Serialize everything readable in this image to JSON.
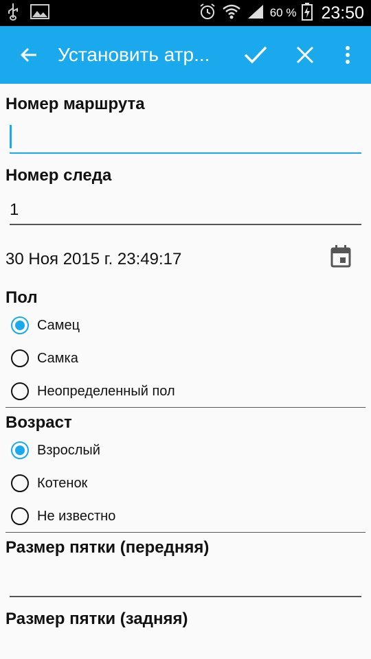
{
  "status_bar": {
    "battery_percent": "60 %",
    "time": "23:50"
  },
  "toolbar": {
    "title": "Установить атр..."
  },
  "form": {
    "route_number": {
      "label": "Номер маршрута",
      "value": ""
    },
    "track_number": {
      "label": "Номер следа",
      "value": "1"
    },
    "datetime": "30 Ноя 2015 г. 23:49:17",
    "sex": {
      "label": "Пол",
      "options": [
        "Самец",
        "Самка",
        "Неопределенный пол"
      ],
      "selected": 0
    },
    "age": {
      "label": "Возраст",
      "options": [
        "Взрослый",
        "Котенок",
        "Не известно"
      ],
      "selected": 0
    },
    "heel_front": {
      "label": "Размер пятки (передняя)",
      "value": ""
    },
    "heel_back": {
      "label": "Размер пятки (задняя)"
    }
  },
  "colors": {
    "accent": "#1ba9ee",
    "background": "#fafafa"
  }
}
